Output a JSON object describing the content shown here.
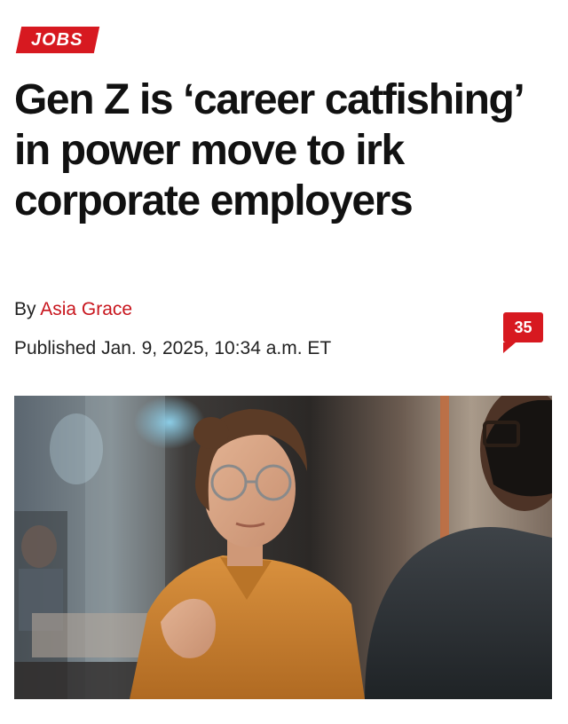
{
  "section": {
    "label": "JOBS",
    "color": "#d71920"
  },
  "article": {
    "headline": "Gen Z is ‘career catfishing’ in power move to irk corporate employers",
    "byline_prefix": "By",
    "author": "Asia Grace",
    "published": "Published Jan. 9, 2025, 10:34 a.m. ET",
    "comment_count": "35",
    "author_color": "#c8151d"
  },
  "hero_image": {
    "subject": "woman-with-glasses-gesturing-in-meeting"
  }
}
